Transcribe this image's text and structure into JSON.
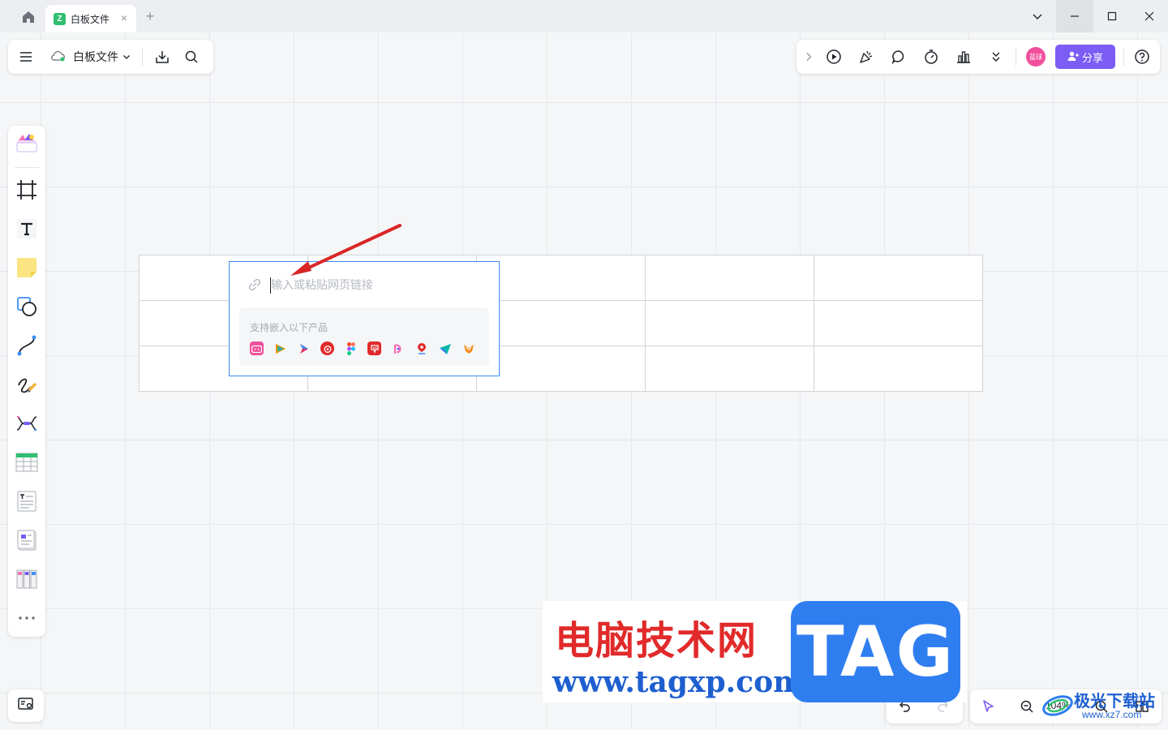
{
  "titlebar": {
    "tab_title": "白板文件",
    "tab_logo": "Z"
  },
  "toolbar_left": {
    "doc_name": "白板文件"
  },
  "toolbar_right": {
    "avatar_label": "蓝球",
    "share_label": "分享"
  },
  "embed": {
    "placeholder": "输入或粘贴网页链接",
    "support_title": "支持嵌入以下产品",
    "apps": [
      "bilibili",
      "tencent-video",
      "youku",
      "netease-music",
      "figma",
      "xiaohongshu",
      "pixso",
      "amap",
      "feishu",
      "mastergo"
    ]
  },
  "zoom": {
    "value": "104%"
  },
  "watermark": {
    "cn": "电脑技术网",
    "url": "www.tagxp.com",
    "tag": "TAG",
    "cn2": "极光下载站",
    "url2": "www.xz7.com"
  },
  "colors": {
    "accent": "#7b5cf5",
    "selection": "#3c8df0",
    "arrow": "#d92626"
  }
}
